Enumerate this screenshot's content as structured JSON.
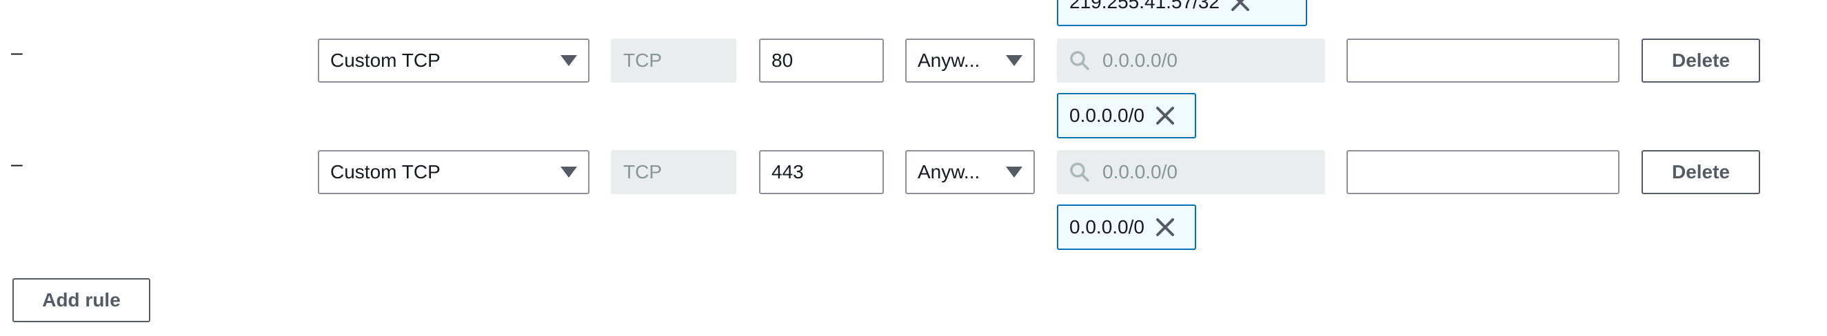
{
  "rows": [
    {
      "dash": "–",
      "type": "Custom TCP",
      "protocol": "TCP",
      "port": "80",
      "source": "Anyw...",
      "search_placeholder": "0.0.0.0/0",
      "description": "",
      "delete_label": "Delete",
      "tokens": [
        "0.0.0.0/0"
      ]
    },
    {
      "dash": "–",
      "type": "Custom TCP",
      "protocol": "TCP",
      "port": "443",
      "source": "Anyw...",
      "search_placeholder": "0.0.0.0/0",
      "description": "",
      "delete_label": "Delete",
      "tokens": [
        "0.0.0.0/0"
      ]
    }
  ],
  "previous_row_token": "219.255.41.57/32",
  "add_rule_label": "Add rule",
  "icons": {
    "dropdown": "caret-down-icon",
    "search": "search-icon",
    "remove": "close-icon"
  },
  "colors": {
    "token_border": "#0073bb",
    "token_bg": "#f1faff",
    "disabled_bg": "#eaeded",
    "button_text": "#545b64"
  }
}
